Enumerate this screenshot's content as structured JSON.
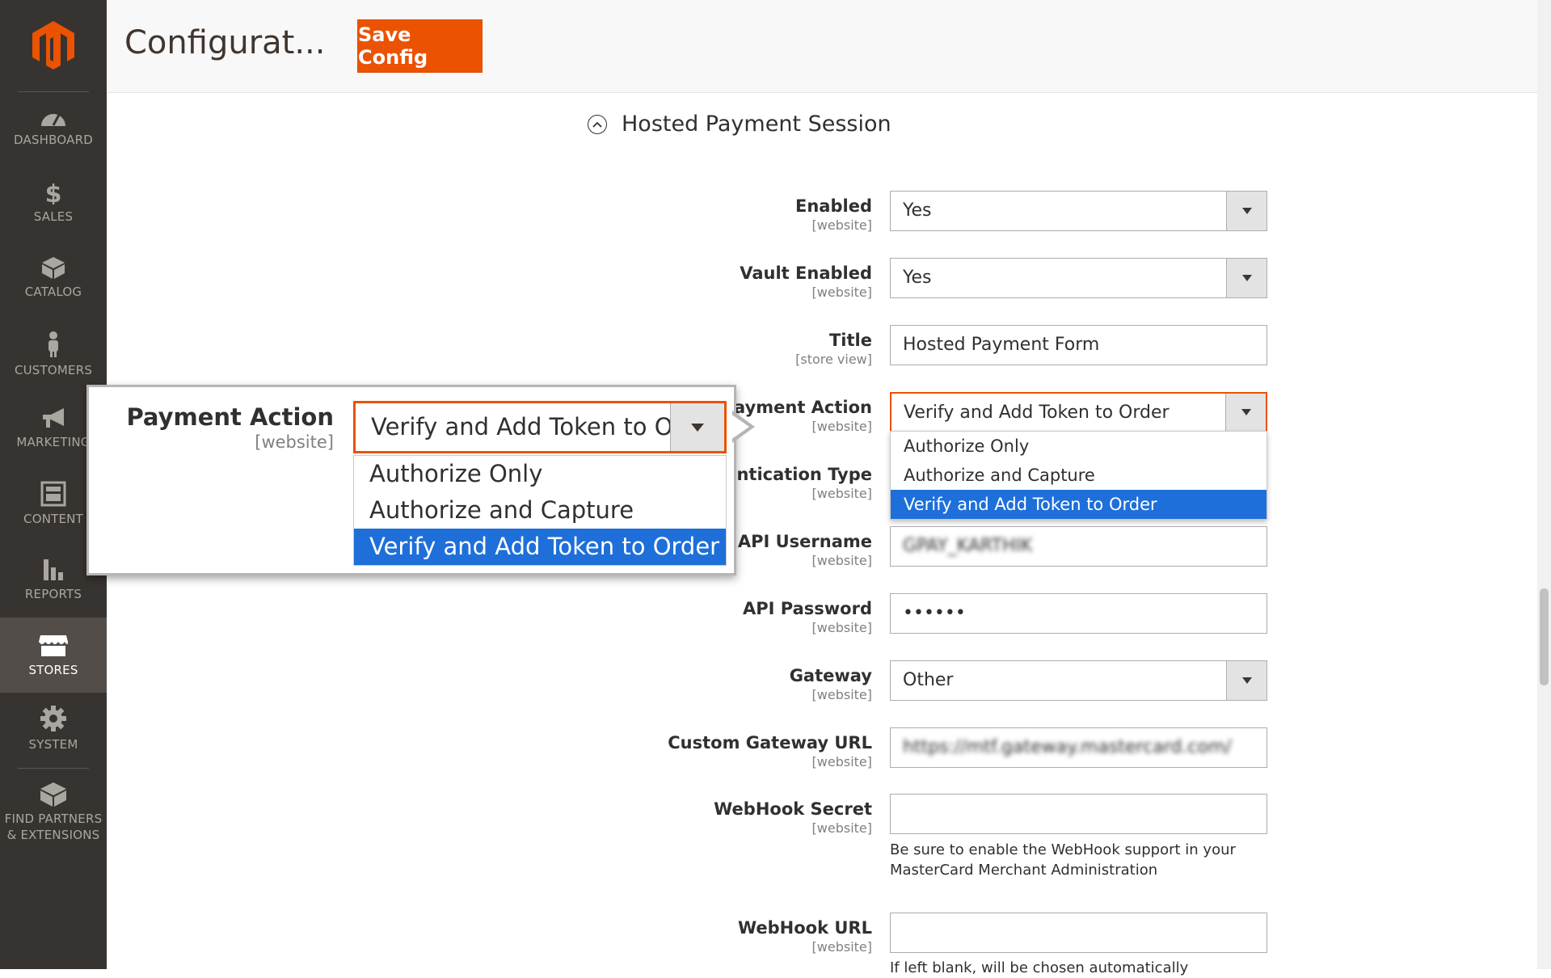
{
  "sidebar": {
    "items": [
      {
        "label": "DASHBOARD",
        "icon": "dashboard-icon"
      },
      {
        "label": "SALES",
        "icon": "dollar-icon"
      },
      {
        "label": "CATALOG",
        "icon": "box-icon"
      },
      {
        "label": "CUSTOMERS",
        "icon": "person-icon"
      },
      {
        "label": "MARKETING",
        "icon": "megaphone-icon"
      },
      {
        "label": "CONTENT",
        "icon": "layout-icon"
      },
      {
        "label": "REPORTS",
        "icon": "bar-chart-icon"
      },
      {
        "label": "STORES",
        "icon": "store-icon"
      },
      {
        "label": "SYSTEM",
        "icon": "gear-icon"
      },
      {
        "label_line1": "FIND PARTNERS",
        "label_line2": "& EXTENSIONS",
        "icon": "blocks-icon"
      }
    ],
    "active": "STORES"
  },
  "header": {
    "title": "Configurat...",
    "save_label": "Save Config"
  },
  "section": {
    "title": "Hosted Payment Session"
  },
  "form": {
    "enabled": {
      "label": "Enabled",
      "scope": "[website]",
      "value": "Yes"
    },
    "vault_enabled": {
      "label": "Vault Enabled",
      "scope": "[website]",
      "value": "Yes"
    },
    "title": {
      "label": "Title",
      "scope": "[store view]",
      "value": "Hosted Payment Form"
    },
    "payment_action": {
      "label": "Payment Action",
      "scope": "[website]",
      "value": "Verify and Add Token to Order"
    },
    "auth_type": {
      "label": "Authentication Type",
      "scope": "[website]"
    },
    "api_username": {
      "label": "API Username",
      "scope": "[website]",
      "value": "GPAY_KARTHIK"
    },
    "api_password": {
      "label": "API Password",
      "scope": "[website]",
      "value": "••••••"
    },
    "gateway": {
      "label": "Gateway",
      "scope": "[website]",
      "value": "Other"
    },
    "custom_gateway_url": {
      "label": "Custom Gateway URL",
      "scope": "[website]",
      "value": "https://mtf.gateway.mastercard.com/"
    },
    "webhook_secret": {
      "label": "WebHook Secret",
      "scope": "[website]",
      "value": "",
      "note": "Be sure to enable the WebHook support in your MasterCard Merchant Administration"
    },
    "webhook_url": {
      "label": "WebHook URL",
      "scope": "[website]",
      "value": "",
      "note": "If left blank, will be chosen automatically"
    }
  },
  "dropdown": {
    "options": [
      "Authorize Only",
      "Authorize and Capture",
      "Verify and Add Token to Order"
    ],
    "selected_index": 2
  },
  "callout": {
    "label": "Payment Action",
    "scope": "[website]",
    "value": "Verify and Add Token to Or"
  },
  "colors": {
    "accent": "#eb5202",
    "sidebar_bg": "#373330",
    "selected_option": "#1e6fd9"
  }
}
